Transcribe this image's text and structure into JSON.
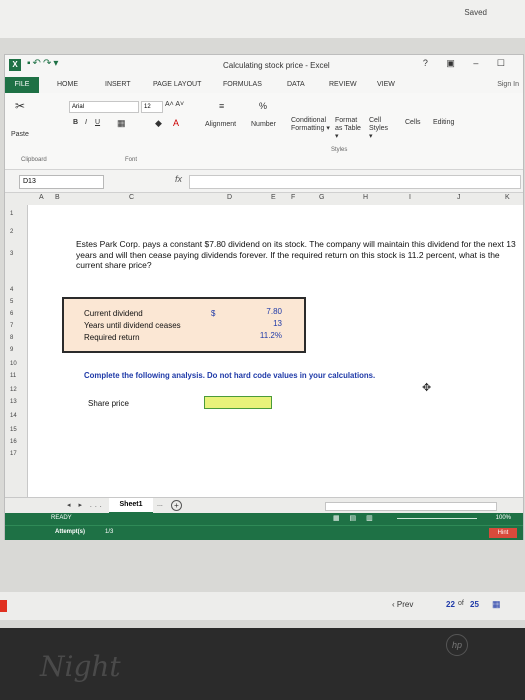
{
  "top": {
    "saved": "Saved"
  },
  "window": {
    "title": "Calculating stock price - Excel",
    "help": "?",
    "controls": "▣ ‒ ☐"
  },
  "tabs": {
    "file": "FILE",
    "home": "HOME",
    "insert": "INSERT",
    "page_layout": "PAGE LAYOUT",
    "formulas": "FORMULAS",
    "data": "DATA",
    "review": "REVIEW",
    "view": "VIEW",
    "sign_in": "Sign In"
  },
  "ribbon": {
    "paste": "Paste",
    "font_name": "Arial",
    "font_size": "12",
    "grow_shrink": "A˄ A˅",
    "bold": "B",
    "italic": "I",
    "underline": "U",
    "percent": "%",
    "alignment": "Alignment",
    "number": "Number",
    "conditional_formatting": "Conditional Formatting ▾",
    "format_as_table": "Format as Table ▾",
    "cell_styles": "Cell Styles ▾",
    "cells": "Cells",
    "editing": "Editing",
    "clipboard_label": "Clipboard",
    "font_label": "Font",
    "styles_label": "Styles"
  },
  "formula_bar": {
    "name_box": "D13",
    "fx": "fx"
  },
  "columns": [
    "A",
    "B",
    "C",
    "D",
    "E",
    "F",
    "G",
    "H",
    "I",
    "J",
    "K"
  ],
  "rows": [
    "1",
    "2",
    "3",
    "4",
    "5",
    "6",
    "7",
    "8",
    "9",
    "10",
    "11",
    "12",
    "13",
    "14",
    "15",
    "16",
    "17"
  ],
  "sheet": {
    "problem": "Estes Park Corp. pays a constant $7.80 dividend on its stock. The company will maintain this dividend for the next 13 years and will then cease paying dividends forever. If the required return on this stock is 11.2 percent, what is the current share price?",
    "inputs": [
      {
        "label": "Current dividend",
        "value": "7.80"
      },
      {
        "label": "Years until dividend ceases",
        "value": "13"
      },
      {
        "label": "Required return",
        "value": "11.2%"
      }
    ],
    "dollar": "$",
    "instruction": "Complete the following analysis. Do not hard code values in your calculations.",
    "output_label": "Share price"
  },
  "sheet_tabs": {
    "nav": "◂ ▸ ...",
    "active": "Sheet1",
    "more": "...",
    "add": "+"
  },
  "status": {
    "ready": "READY",
    "views": "▦ ▤ ▥",
    "zoom": "100%",
    "attempts_label": "Attempt(s)",
    "attempts_value": "1/3",
    "hint": "Hint"
  },
  "navigation": {
    "prev": "‹ Prev",
    "current": "22",
    "of": "of",
    "total": "25",
    "grid": "▦"
  },
  "decor": {
    "logo": "hp",
    "night": "Night"
  }
}
